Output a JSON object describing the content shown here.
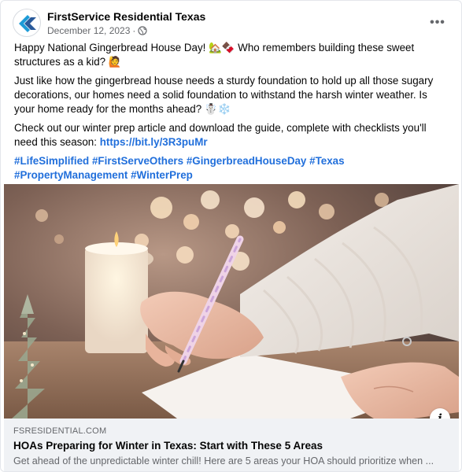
{
  "post": {
    "page_name": "FirstService Residential Texas",
    "date": "December 12, 2023",
    "separator": "·",
    "more_label": "•••",
    "paragraphs": {
      "p1": "Happy National Gingerbread House Day! 🏡🍫 Who remembers building these sweet structures as a kid? 🙋",
      "p2": "Just like how the gingerbread house needs a sturdy foundation to hold up all those sugary decorations, our homes need a solid foundation to withstand the harsh winter weather. Is your home ready for the months ahead? ☃️❄️",
      "p3_text": "Check out our winter prep article and download the guide, complete with checklists you'll need this season: ",
      "p3_link": "https://bit.ly/3R3puMr"
    },
    "hashtags": [
      "#LifeSimplified",
      "#FirstServeOthers",
      "#GingerbreadHouseDay",
      "#Texas",
      "#PropertyManagement",
      "#WinterPrep"
    ]
  },
  "photo": {
    "description_icon": "photo-hand-writing-candle"
  },
  "info_label": "i",
  "link_preview": {
    "domain": "FSRESIDENTIAL.COM",
    "title": "HOAs Preparing for Winter in Texas: Start with These 5 Areas",
    "description": "Get ahead of the unpredictable winter chill! Here are 5 areas your HOA should prioritize when ..."
  },
  "colors": {
    "link": "#216fdb",
    "brand_blue": "#1d9bd7",
    "meta_gray": "#65676b",
    "preview_bg": "#f0f2f5"
  }
}
